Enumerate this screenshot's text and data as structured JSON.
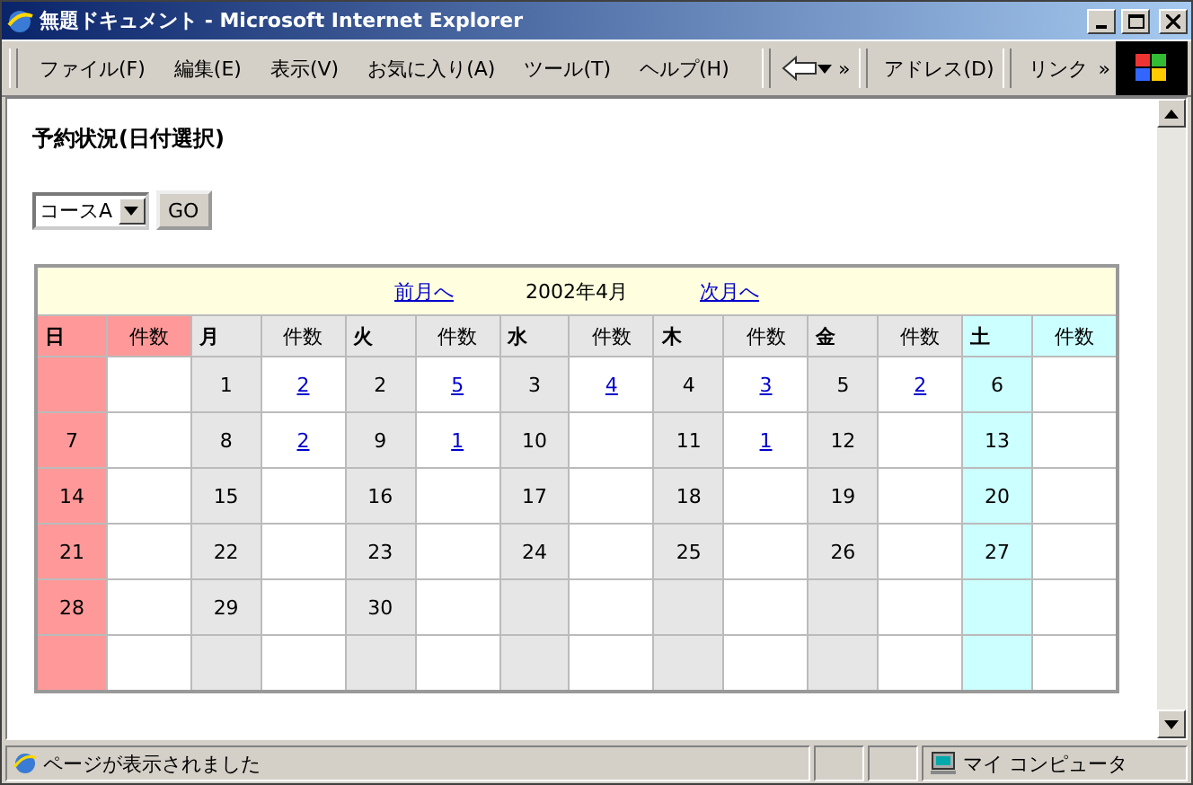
{
  "window": {
    "title": "無題ドキュメント - Microsoft Internet Explorer"
  },
  "menu": [
    "ファイル(F)",
    "編集(E)",
    "表示(V)",
    "お気に入り(A)",
    "ツール(T)",
    "ヘルプ(H)"
  ],
  "toolbar": {
    "more": "»",
    "address_label": "アドレス(D)",
    "links_label": "リンク",
    "links_more": "»"
  },
  "page": {
    "heading": "予約状況(日付選択)",
    "course": "コースA",
    "go": "GO",
    "calendar": {
      "prev": "前月へ",
      "month": "2002年4月",
      "next": "次月へ",
      "weekdays": [
        {
          "name": "日",
          "count_label": "件数",
          "color": "#ff9999"
        },
        {
          "name": "月",
          "count_label": "件数",
          "color": "#e6e6e6"
        },
        {
          "name": "火",
          "count_label": "件数",
          "color": "#e6e6e6"
        },
        {
          "name": "水",
          "count_label": "件数",
          "color": "#e6e6e6"
        },
        {
          "name": "木",
          "count_label": "件数",
          "color": "#e6e6e6"
        },
        {
          "name": "金",
          "count_label": "件数",
          "color": "#e6e6e6"
        },
        {
          "name": "土",
          "count_label": "件数",
          "color": "#ccffff"
        }
      ],
      "weeks": [
        [
          {
            "kind": "blank"
          },
          {
            "kind": "date",
            "day": "1",
            "count": "2"
          },
          {
            "kind": "date",
            "day": "2",
            "count": "5"
          },
          {
            "kind": "date",
            "day": "3",
            "count": "4"
          },
          {
            "kind": "date",
            "day": "4",
            "count": "3"
          },
          {
            "kind": "date",
            "day": "5",
            "count": "2"
          },
          {
            "kind": "date",
            "day": "6"
          }
        ],
        [
          {
            "kind": "date",
            "day": "7"
          },
          {
            "kind": "date",
            "day": "8",
            "count": "2"
          },
          {
            "kind": "date",
            "day": "9",
            "count": "1"
          },
          {
            "kind": "date",
            "day": "10"
          },
          {
            "kind": "date",
            "day": "11",
            "count": "1"
          },
          {
            "kind": "date",
            "day": "12"
          },
          {
            "kind": "date",
            "day": "13"
          }
        ],
        [
          {
            "kind": "date",
            "day": "14"
          },
          {
            "kind": "date",
            "day": "15"
          },
          {
            "kind": "date",
            "day": "16"
          },
          {
            "kind": "date",
            "day": "17"
          },
          {
            "kind": "date",
            "day": "18"
          },
          {
            "kind": "date",
            "day": "19"
          },
          {
            "kind": "date",
            "day": "20"
          }
        ],
        [
          {
            "kind": "date",
            "day": "21"
          },
          {
            "kind": "date",
            "day": "22"
          },
          {
            "kind": "date",
            "day": "23"
          },
          {
            "kind": "date",
            "day": "24"
          },
          {
            "kind": "date",
            "day": "25"
          },
          {
            "kind": "date",
            "day": "26"
          },
          {
            "kind": "date",
            "day": "27"
          }
        ],
        [
          {
            "kind": "date",
            "day": "28"
          },
          {
            "kind": "date",
            "day": "29"
          },
          {
            "kind": "date",
            "day": "30"
          },
          {
            "kind": "blank"
          },
          {
            "kind": "blank"
          },
          {
            "kind": "blank"
          },
          {
            "kind": "blank"
          }
        ],
        [
          {
            "kind": "blank"
          },
          {
            "kind": "blank"
          },
          {
            "kind": "blank"
          },
          {
            "kind": "blank"
          },
          {
            "kind": "blank"
          },
          {
            "kind": "blank"
          },
          {
            "kind": "blank"
          }
        ]
      ]
    }
  },
  "status_bar": {
    "message": "ページが表示されました",
    "zone": "マイ コンピュータ"
  }
}
